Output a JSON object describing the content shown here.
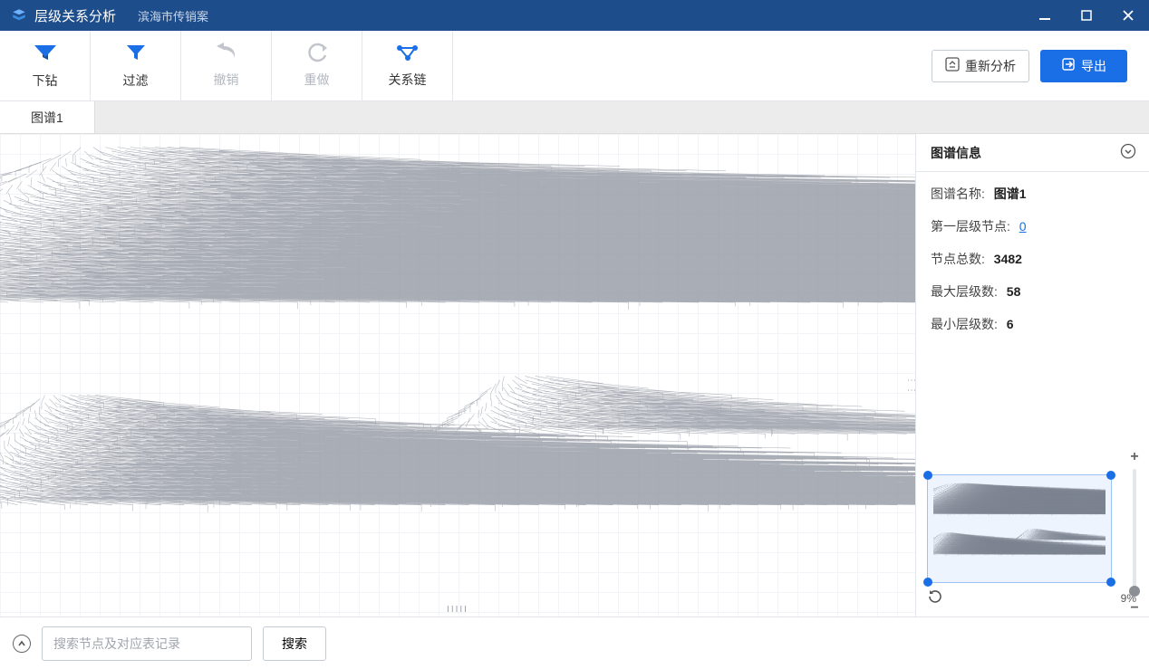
{
  "titlebar": {
    "app_title": "层级关系分析",
    "case_name": "滨海市传销案"
  },
  "toolbar": {
    "drill_label": "下钻",
    "filter_label": "过滤",
    "undo_label": "撤销",
    "redo_label": "重做",
    "chain_label": "关系链",
    "reanalyze_label": "重新分析",
    "export_label": "导出"
  },
  "tabs": {
    "tab1_label": "图谱1"
  },
  "panel": {
    "title": "图谱信息",
    "name_label": "图谱名称:",
    "name_value": "图谱1",
    "first_level_label": "第一层级节点:",
    "first_level_value": "0",
    "total_nodes_label": "节点总数:",
    "total_nodes_value": "3482",
    "max_levels_label": "最大层级数:",
    "max_levels_value": "58",
    "min_levels_label": "最小层级数:",
    "min_levels_value": "6"
  },
  "minimap": {
    "zoom_pct": "9%"
  },
  "bottombar": {
    "search_placeholder": "搜索节点及对应表记录",
    "search_button": "搜索"
  },
  "colors": {
    "titlebar_bg": "#1e4d8b",
    "primary_blue": "#1b6fe6"
  }
}
